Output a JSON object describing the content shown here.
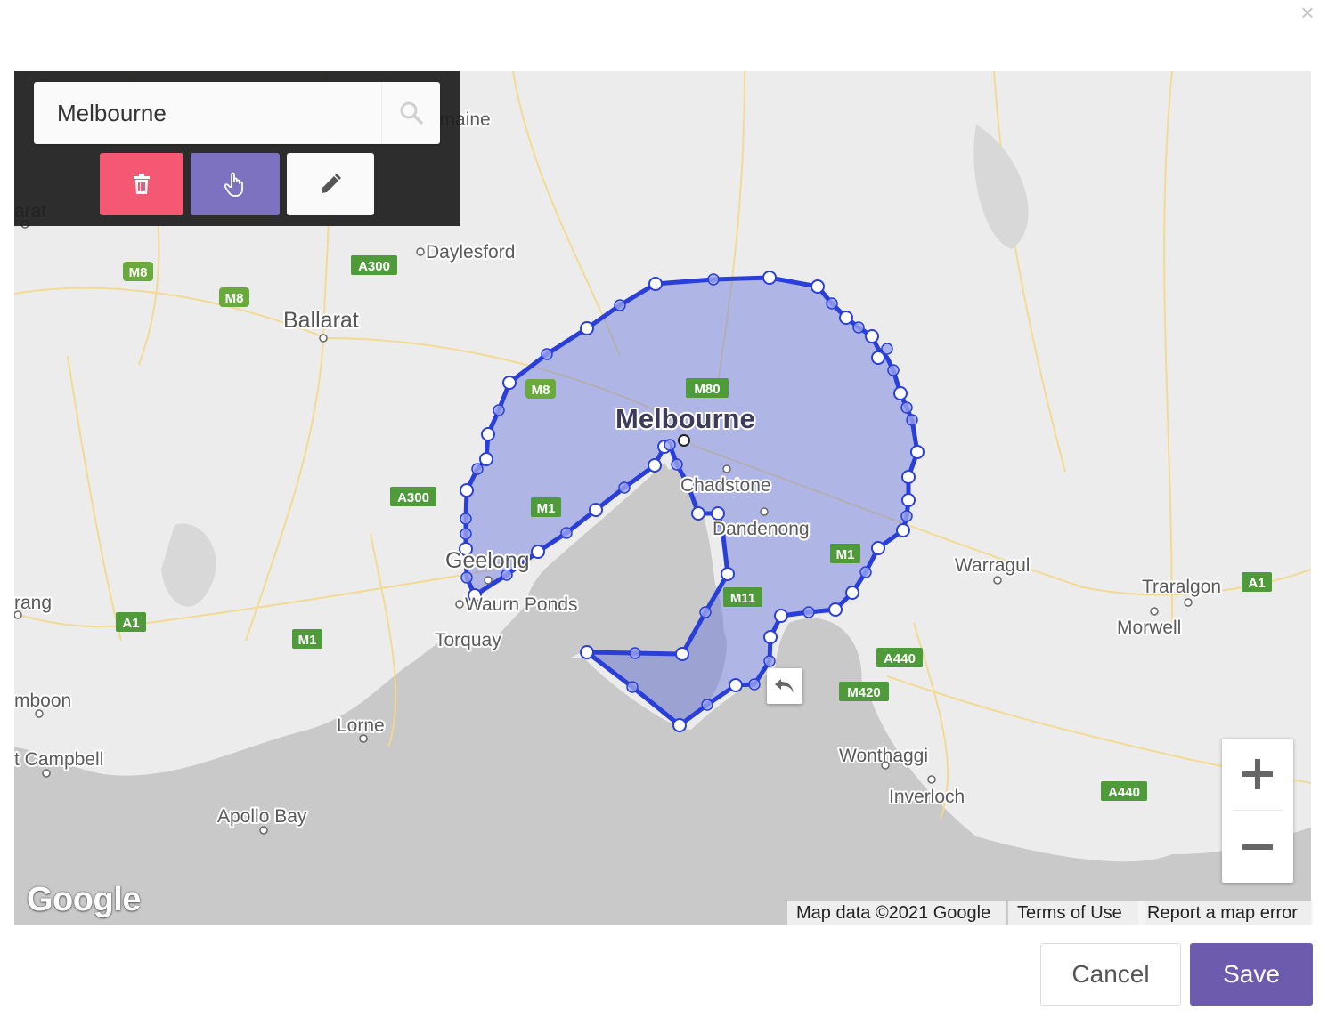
{
  "dialog": {
    "close_icon": "close-icon",
    "close_glyph": "×"
  },
  "toolbar": {
    "search": {
      "value": "Melbourne",
      "icon": "search-icon"
    },
    "delete": {
      "icon": "trash-icon",
      "color": "#f55873"
    },
    "pan": {
      "icon": "hand-pointer-icon",
      "color": "#7c72c0"
    },
    "edit": {
      "icon": "pencil-icon",
      "color": "#fafafa"
    }
  },
  "map": {
    "place_labels": [
      "Castlemaine",
      "Daylesford",
      "Ballarat",
      "Melbourne",
      "Chadstone",
      "Dandenong",
      "Geelong",
      "Waurn Ponds",
      "Torquay",
      "Lorne",
      "Apollo Bay",
      "Warragul",
      "Traralgon",
      "Morwell",
      "Wonthaggi",
      "Inverloch",
      "arat",
      "rang",
      "mboon",
      "t Campbell"
    ],
    "road_shields": [
      "M8",
      "M8",
      "A300",
      "M8",
      "M80",
      "A300",
      "M1",
      "M1",
      "M11",
      "A1",
      "M1",
      "A1",
      "A440",
      "M420",
      "A440"
    ],
    "polygon_fill": "#6675e0",
    "polygon_stroke": "#2a3fd9",
    "undo_icon": "undo-icon",
    "zoom_in_icon": "plus-icon",
    "zoom_out_icon": "minus-icon",
    "logo": "Google",
    "attribution": {
      "data": "Map data ©2021 Google",
      "terms": "Terms of Use",
      "report": "Report a map error"
    }
  },
  "footer": {
    "cancel": "Cancel",
    "save": "Save",
    "save_color": "#6d5cae"
  }
}
